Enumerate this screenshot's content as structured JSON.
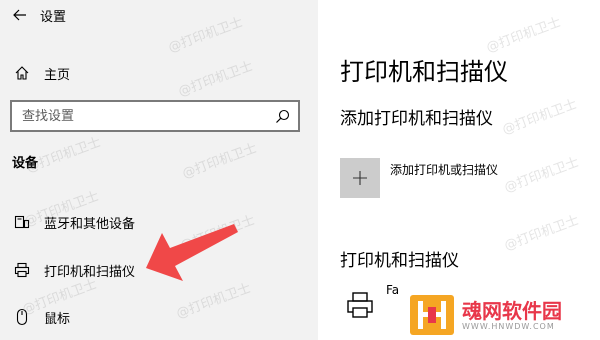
{
  "app": {
    "title": "设置"
  },
  "sidebar": {
    "home_label": "主页",
    "search_placeholder": "查找设置",
    "section_header": "设备",
    "items": [
      {
        "label": "蓝牙和其他设备",
        "icon": "bluetooth-devices-icon"
      },
      {
        "label": "打印机和扫描仪",
        "icon": "printer-icon"
      },
      {
        "label": "鼠标",
        "icon": "mouse-icon"
      }
    ]
  },
  "main": {
    "page_title": "打印机和扫描仪",
    "add_section_title": "添加打印机和扫描仪",
    "add_button_label": "添加打印机或扫描仪",
    "list_section_title": "打印机和扫描仪",
    "printers": [
      {
        "name": "Fa"
      }
    ]
  },
  "watermark_text": "@打印机卫士",
  "logo": {
    "name": "魂网软件园",
    "url": "WWW.HNWDW.COM"
  },
  "colors": {
    "sidebar_bg": "#f2f2f2",
    "tile_bg": "#cccccc",
    "arrow": "#f04848",
    "logo_red": "#e8374a"
  }
}
